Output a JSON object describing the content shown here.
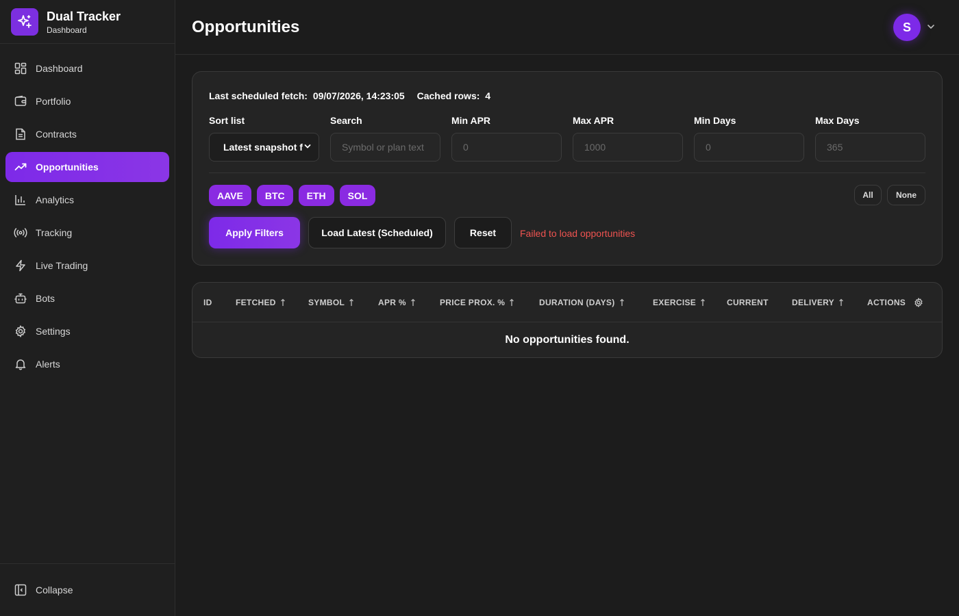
{
  "brand": {
    "title": "Dual Tracker",
    "subtitle": "Dashboard"
  },
  "nav": [
    {
      "label": "Dashboard",
      "icon": "layout-grid-icon"
    },
    {
      "label": "Portfolio",
      "icon": "wallet-icon"
    },
    {
      "label": "Contracts",
      "icon": "file-icon"
    },
    {
      "label": "Opportunities",
      "icon": "trending-up-icon",
      "active": true
    },
    {
      "label": "Analytics",
      "icon": "bar-chart-icon"
    },
    {
      "label": "Tracking",
      "icon": "radio-icon"
    },
    {
      "label": "Live Trading",
      "icon": "zap-icon"
    },
    {
      "label": "Bots",
      "icon": "bot-icon"
    },
    {
      "label": "Settings",
      "icon": "gear-icon"
    },
    {
      "label": "Alerts",
      "icon": "bell-icon"
    }
  ],
  "collapse_label": "Collapse",
  "header": {
    "title": "Opportunities",
    "avatar_initial": "S"
  },
  "status": {
    "fetch_label": "Last scheduled fetch:",
    "fetch_value": "09/07/2026, 14:23:05",
    "rows_label": "Cached rows:",
    "rows_value": "4"
  },
  "filters": {
    "sort": {
      "label": "Sort list",
      "value": "Latest snapshot f"
    },
    "search": {
      "label": "Search",
      "placeholder": "Symbol or plan text"
    },
    "min_apr": {
      "label": "Min APR",
      "placeholder": "0"
    },
    "max_apr": {
      "label": "Max APR",
      "placeholder": "1000"
    },
    "min_days": {
      "label": "Min Days",
      "placeholder": "0"
    },
    "max_days": {
      "label": "Max Days",
      "placeholder": "365"
    }
  },
  "symbols": [
    "AAVE",
    "BTC",
    "ETH",
    "SOL"
  ],
  "select_all": "All",
  "select_none": "None",
  "buttons": {
    "apply": "Apply Filters",
    "load_latest": "Load Latest (Scheduled)",
    "reset": "Reset"
  },
  "error_message": "Failed to load opportunities",
  "table": {
    "columns": [
      {
        "label": "ID",
        "sortable": false
      },
      {
        "label": "FETCHED",
        "sortable": true
      },
      {
        "label": "SYMBOL",
        "sortable": true
      },
      {
        "label": "APR %",
        "sortable": true
      },
      {
        "label": "PRICE PROX. %",
        "sortable": true
      },
      {
        "label": "DURATION (DAYS)",
        "sortable": true
      },
      {
        "label": "EXERCISE",
        "sortable": true
      },
      {
        "label": "CURRENT",
        "sortable": false
      },
      {
        "label": "DELIVERY",
        "sortable": true
      },
      {
        "label": "ACTIONS",
        "sortable": false
      }
    ],
    "empty_message": "No opportunities found."
  },
  "colors": {
    "accent": "#7d2ae8",
    "error": "#ef5350",
    "background": "#1c1c1c"
  }
}
